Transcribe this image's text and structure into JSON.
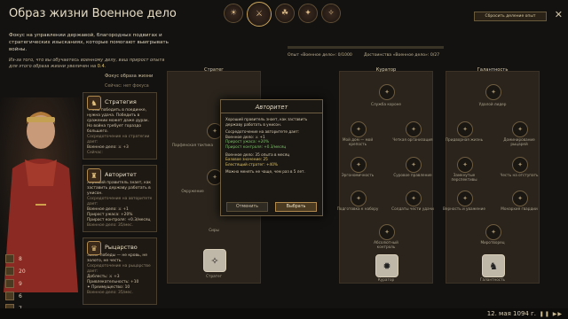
{
  "header": {
    "title": "Образ жизни Военное дело",
    "reset_button": "Сбросить деление опыт",
    "close": "✕"
  },
  "intro": {
    "text": "Фокус на управлении державой, благородных подвигах и стратегических изысканиях, которые помогают выигрывать войны.",
    "note_prefix": "Из-за того, что вы обучаетесь военному делу, ваш прирост опыта для этого образа жизни увеличен на ",
    "note_value": "0.4",
    "note_suffix": "."
  },
  "top_icons": [
    "☀",
    "⚔",
    "☘",
    "✦",
    "✧"
  ],
  "progress": {
    "xp_label": "Опыт «Военное дело»: 0/1000",
    "achievements_label": "Достоинства «Военное дело»: 0/27"
  },
  "lifestyle": {
    "focus_label": "Фокус образа жизни",
    "focus_status": "Сейчас: нет фокуса"
  },
  "perks": [
    {
      "icon": "♞",
      "title": "Стратегия",
      "desc": "Чтобы победить в поединке, нужна удача. Победить в сражении может даже дурак. Но война требует гораздо большего.",
      "lines": [
        "Сосредоточение на стратегии дает:",
        "Военное дело: ⚔ +3",
        "Сейчас:"
      ]
    },
    {
      "icon": "♜",
      "title": "Авторитет",
      "desc": "Хороший правитель знает, как заставить державу работать в унисон.",
      "lines": [
        "Сосредоточение на авторитете дает:",
        "Военное дело: ⚔ +1",
        "Прирост ужаса: +20%",
        "Прирост контроля: +0.3/месяц",
        "Военное дело: 35/мес."
      ]
    },
    {
      "icon": "♛",
      "title": "Рыцарство",
      "desc": "Залог победы — не кровь, не золото, не честь.",
      "lines": [
        "Сосредоточение на рыцарстве дает:",
        "Доблесть: ⚔ +3",
        "Привлекательность: +10",
        "✦ Преимущество: 10",
        "Военное дело: 35/мес."
      ]
    }
  ],
  "stat_rail": [
    "8",
    "20",
    "9",
    "6",
    "7"
  ],
  "columns": [
    {
      "title": "Стратег",
      "nodes": [
        "Парфянская тактика",
        "Окружение",
        "Сиры"
      ],
      "bottom": "Стратег"
    },
    {
      "title": "Куратор",
      "nodes": [
        "Служба короне",
        "Мой дом — мой крепость",
        "Четкая организация",
        "Эргономичность",
        "Суровое правление",
        "Подготовка к набору",
        "Солдаты чести удачи",
        "Абсолютный контроль"
      ],
      "bottom": "Куратор"
    },
    {
      "title": "Галантность",
      "nodes": [
        "Удалой лидер",
        "Придворная жизнь",
        "Доминирование рыцарей",
        "Замкнутые перспективы",
        "Честь на отступать",
        "Верность и уважение",
        "Монархия гвардии",
        "Миротворец"
      ],
      "bottom": "Галантность"
    }
  ],
  "modal": {
    "title": "Авторитет",
    "desc": "Хороший правитель знает, как заставить державу работать в унисон.",
    "focus_head": "Сосредоточение на авторитете дает:",
    "mil": "Военное дело: ⚔ +1",
    "dread": "Прирост ужаса: +20%",
    "control": "Прирост контроля: +0.3/месяц",
    "xp_head": "Военное дело: 35 опыта в месяц",
    "base": "Базовое значение: 25",
    "brilliant": "Блестящий стратег: +40%",
    "change_note": "Можно менять не чаще, чем раз в 5 лет.",
    "cancel": "Отменить",
    "confirm": "Выбрать"
  },
  "footer": {
    "date": "12. мая 1094 г.",
    "speed": "❚❚ ▶▶"
  }
}
